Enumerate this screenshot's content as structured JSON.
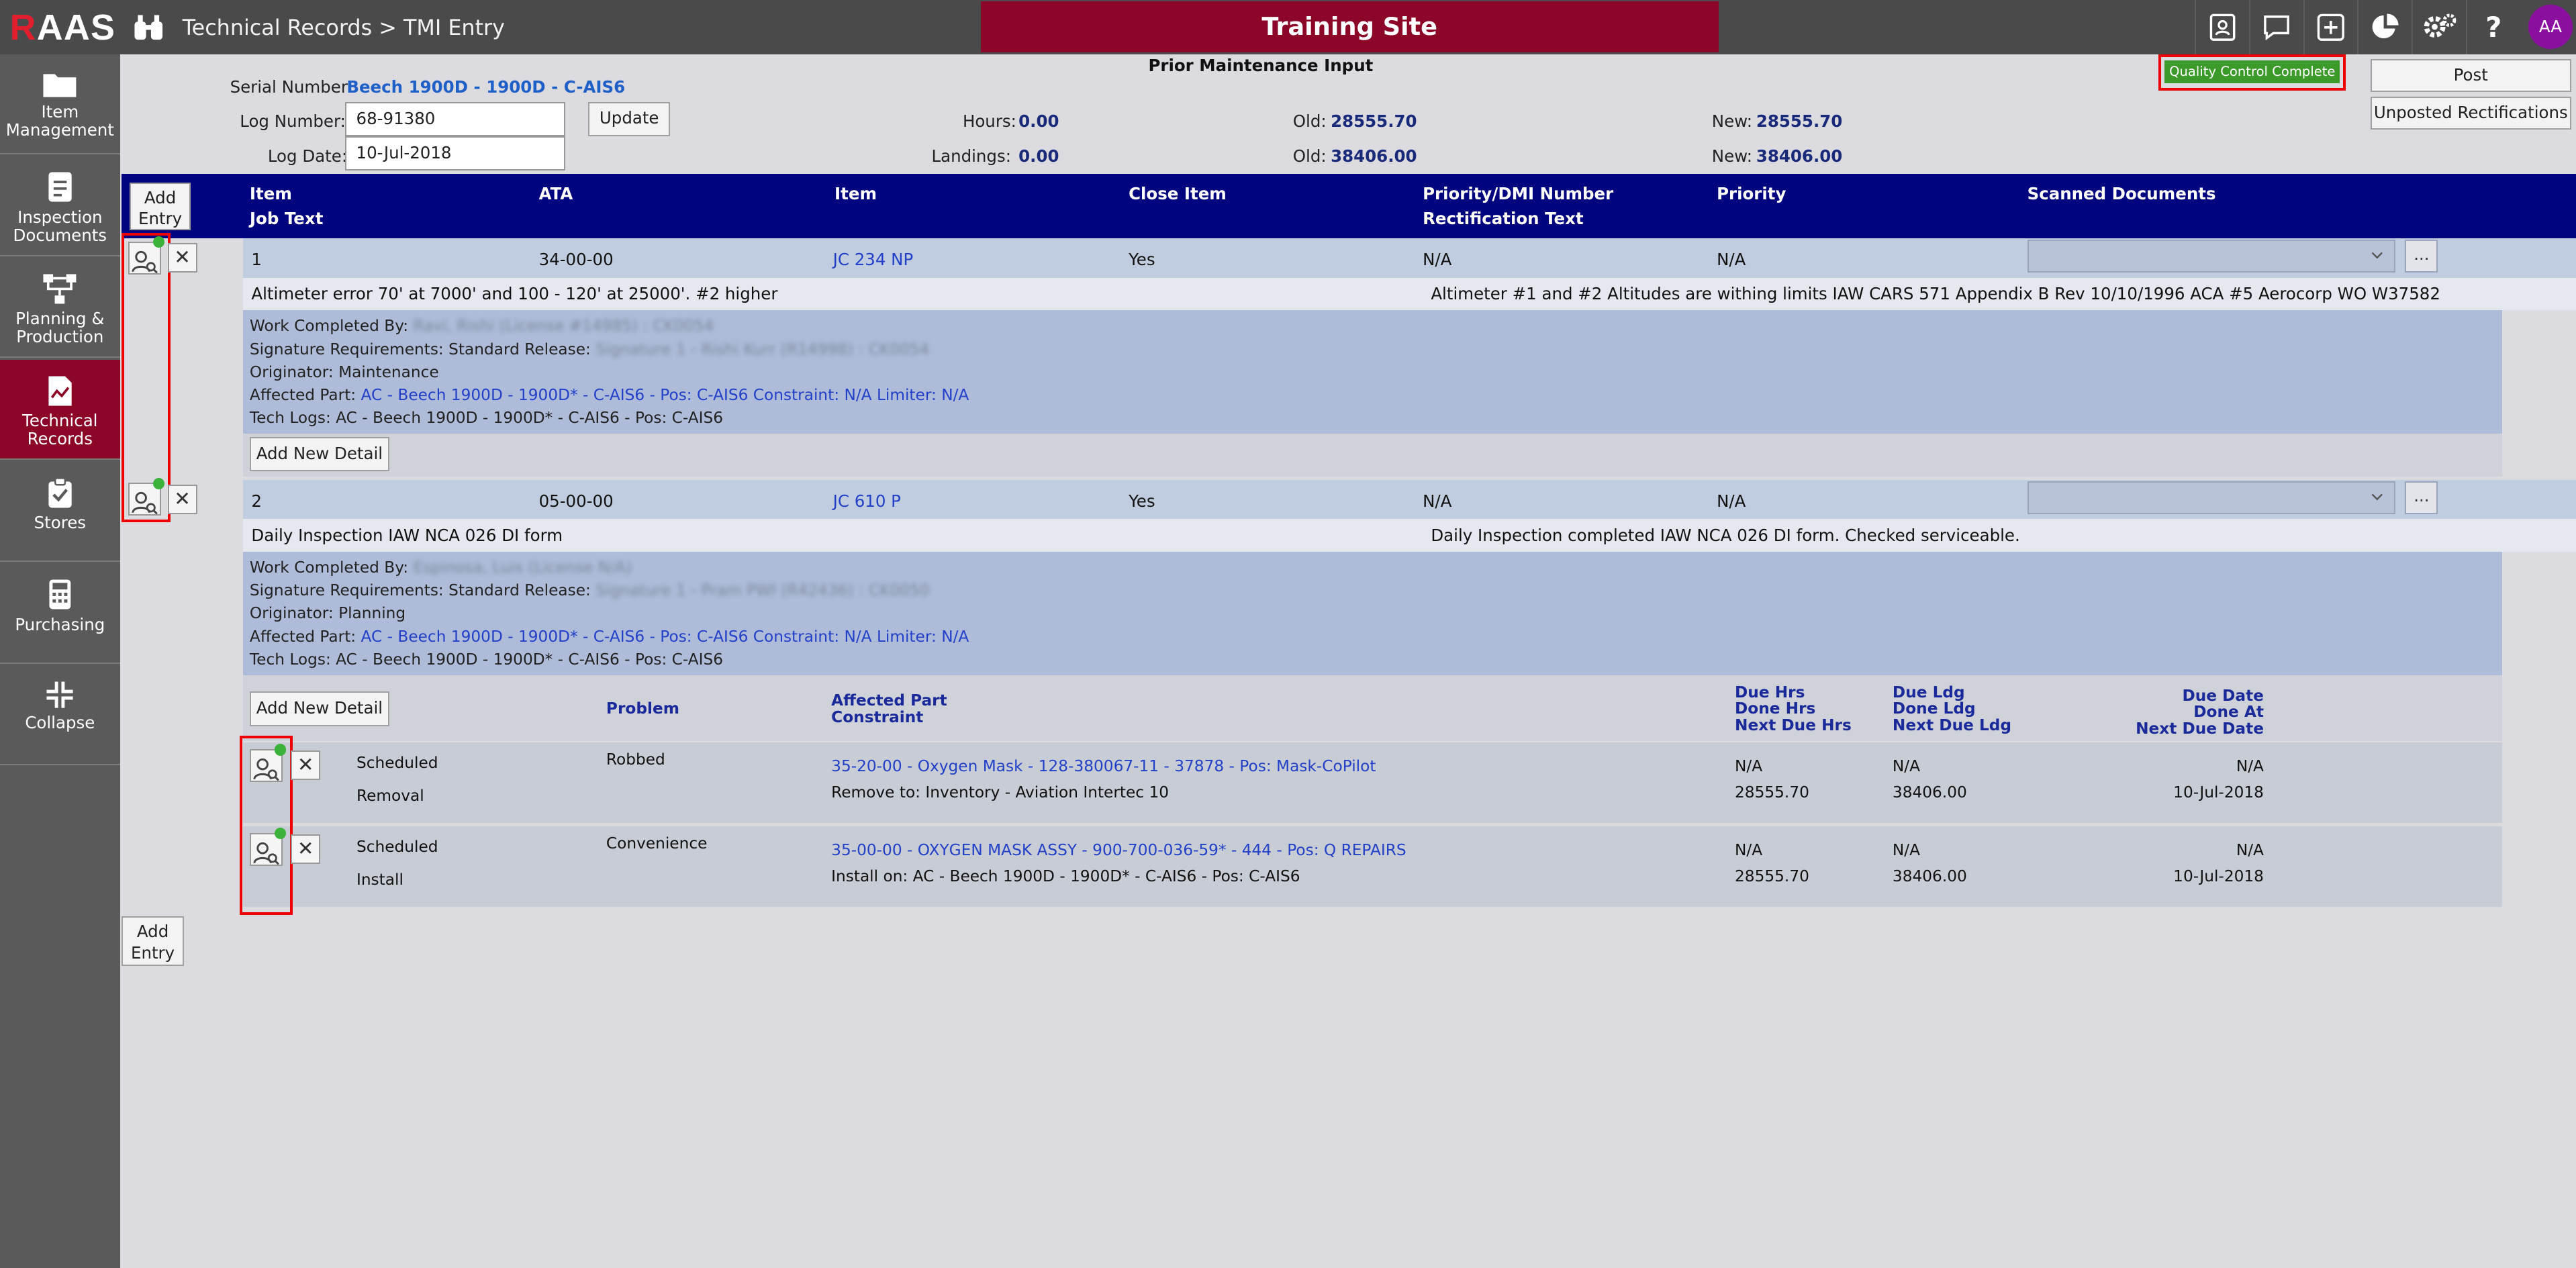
{
  "app": {
    "logo_r": "R",
    "logo_rest": "AAS",
    "breadcrumb": "Technical Records > TMI Entry",
    "site_name": "Training Site",
    "user_initials": "AA"
  },
  "toolbar_icons": [
    "contacts-icon",
    "chat-icon",
    "add-icon",
    "pie-chart-icon",
    "settings-icon",
    "help-icon"
  ],
  "sidebar": [
    {
      "label": "Item Management",
      "icon": "folder-icon"
    },
    {
      "label": "Inspection Documents",
      "icon": "document-icon"
    },
    {
      "label": "Planning & Production",
      "icon": "flow-icon"
    },
    {
      "label": "Technical Records",
      "icon": "chart-doc-icon",
      "active": true
    },
    {
      "label": "Stores",
      "icon": "clipboard-check-icon"
    },
    {
      "label": "Purchasing",
      "icon": "calculator-icon"
    },
    {
      "label": "Collapse",
      "icon": "collapse-icon"
    }
  ],
  "header": {
    "serial_label": "Serial Number:",
    "serial_value": "Beech 1900D - 1900D - C-AIS6",
    "log_number_label": "Log Number:",
    "log_number": "68-91380",
    "log_date_label": "Log Date:",
    "log_date": "10-Jul-2018",
    "update_button": "Update",
    "section_title": "Prior Maintenance Input",
    "hours_label": "Hours:",
    "hours": "0.00",
    "landings_label": "Landings:",
    "landings": "0.00",
    "old_label": "Old:",
    "old_hours": "28555.70",
    "old_landings": "38406.00",
    "new_label": "New:",
    "new_hours": "28555.70",
    "new_landings": "38406.00",
    "qc_badge": "Quality Control Complete",
    "post_button": "Post",
    "unposted_button": "Unposted Rectifications",
    "accent": "#8c0628"
  },
  "table_header": {
    "add_entry": "Add Entry",
    "item": "Item",
    "job_text": "Job Text",
    "ata": "ATA",
    "item2": "Item",
    "close_item": "Close Item",
    "priority_dmi": "Priority/DMI Number",
    "rect_text": "Rectification Text",
    "priority": "Priority",
    "scanned": "Scanned Documents"
  },
  "entries": [
    {
      "item": "1",
      "ata": "34-00-00",
      "item_link": "JC 234 NP",
      "close": "Yes",
      "dmi": "N/A",
      "priority": "N/A",
      "job_text": "Altimeter error 70' at 7000' and 100 - 120' at 25000'. #2 higher",
      "rect_text": "Altimeter #1 and #2 Altitudes are withing limits IAW CARS 571 Appendix B Rev 10/10/1996 ACA #5 Aerocorp WO W37582",
      "work_completed_label": "Work Completed By:",
      "work_completed": "Ravi, Rishi (License #14985) : CK0054",
      "sig_label": "Signature Requirements: Standard Release:",
      "sig": "Signature 1 - Rishi Kurr (R14998) : CK0054",
      "originator": "Originator: Maintenance",
      "affected_label": "Affected Part:",
      "affected": "AC - Beech 1900D - 1900D* - C-AIS6 - Pos: C-AIS6 Constraint: N/A Limiter: N/A",
      "tech_logs": "Tech Logs: AC - Beech 1900D - 1900D* - C-AIS6 - Pos: C-AIS6",
      "add_detail": "Add New Detail"
    },
    {
      "item": "2",
      "ata": "05-00-00",
      "item_link": "JC 610 P",
      "close": "Yes",
      "dmi": "N/A",
      "priority": "N/A",
      "job_text": "Daily Inspection IAW NCA 026 DI form",
      "rect_text": "Daily Inspection completed IAW NCA 026 DI form. Checked serviceable.",
      "work_completed_label": "Work Completed By:",
      "work_completed": "Espinosa, Luis (License N/A)",
      "sig_label": "Signature Requirements: Standard Release:",
      "sig": "Signature 1 - Pram PWI (R42436) : CK0050",
      "originator": "Originator: Planning",
      "affected_label": "Affected Part:",
      "affected": "AC - Beech 1900D - 1900D* - C-AIS6 - Pos: C-AIS6 Constraint: N/A Limiter: N/A",
      "tech_logs": "Tech Logs: AC - Beech 1900D - 1900D* - C-AIS6 - Pos: C-AIS6",
      "add_detail": "Add New Detail"
    }
  ],
  "parts_header": {
    "problem": "Problem",
    "affected_part": "Affected Part",
    "constraint": "Constraint",
    "due_hrs": "Due Hrs",
    "done_hrs": "Done Hrs",
    "next_due_hrs": "Next Due Hrs",
    "due_ldg": "Due Ldg",
    "done_ldg": "Done Ldg",
    "next_due_ldg": "Next Due Ldg",
    "due_date": "Due Date",
    "done_at": "Done At",
    "next_due_date": "Next Due Date"
  },
  "parts": [
    {
      "type1": "Scheduled",
      "type2": "Removal",
      "problem": "Robbed",
      "part": "35-20-00 - Oxygen Mask - 128-380067-11 - 37878 - Pos: Mask-CoPilot",
      "action": "Remove to: Inventory - Aviation Intertec 10",
      "due_hrs": "N/A",
      "done_hrs": "28555.70",
      "due_ldg": "N/A",
      "done_ldg": "38406.00",
      "due_date": "N/A",
      "done_at": "10-Jul-2018"
    },
    {
      "type1": "Scheduled",
      "type2": "Install",
      "problem": "Convenience",
      "part": "35-00-00 - OXYGEN MASK ASSY - 900-700-036-59* - 444 - Pos: Q REPAIRS",
      "action": "Install on: AC - Beech 1900D - 1900D* - C-AIS6 - Pos: C-AIS6",
      "due_hrs": "N/A",
      "done_hrs": "28555.70",
      "due_ldg": "N/A",
      "done_ldg": "38406.00",
      "due_date": "N/A",
      "done_at": "10-Jul-2018"
    }
  ],
  "footer": {
    "add_entry": "Add Entry"
  }
}
